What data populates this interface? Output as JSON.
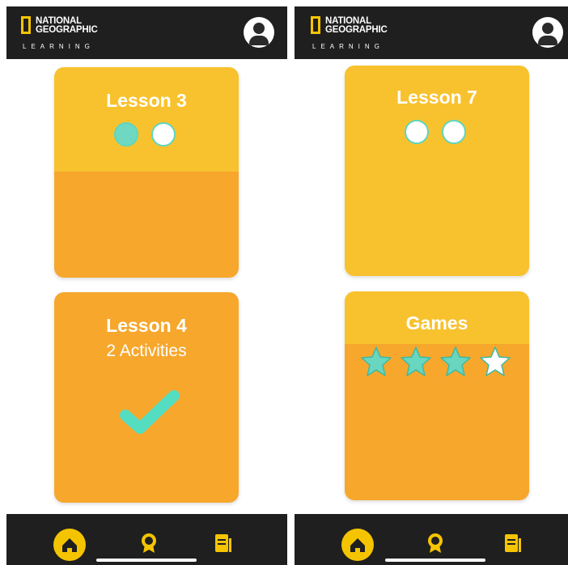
{
  "brand": {
    "line1": "NATIONAL",
    "line2": "GEOGRAPHIC",
    "line3": "LEARNING"
  },
  "left_screen": {
    "cards": [
      {
        "title": "Lesson 3",
        "progress_dots": [
          "completed",
          "empty"
        ]
      },
      {
        "title": "Lesson 4",
        "subtitle": "2 Activities",
        "status": "completed-check"
      }
    ]
  },
  "right_screen": {
    "cards": [
      {
        "title": "Lesson 7",
        "progress_dots": [
          "empty",
          "empty"
        ]
      },
      {
        "title": "Games",
        "stars_earned": 3,
        "stars_total": 4
      }
    ]
  },
  "nav": {
    "items": [
      "home-icon",
      "badge-icon",
      "book-icon"
    ],
    "active": "home-icon"
  },
  "colors": {
    "header_bg": "#1f1f1f",
    "card_yellow": "#f8c22e",
    "card_orange": "#f6a72c",
    "accent_teal": "#5fd5bf",
    "logo_yellow": "#f5c500"
  }
}
